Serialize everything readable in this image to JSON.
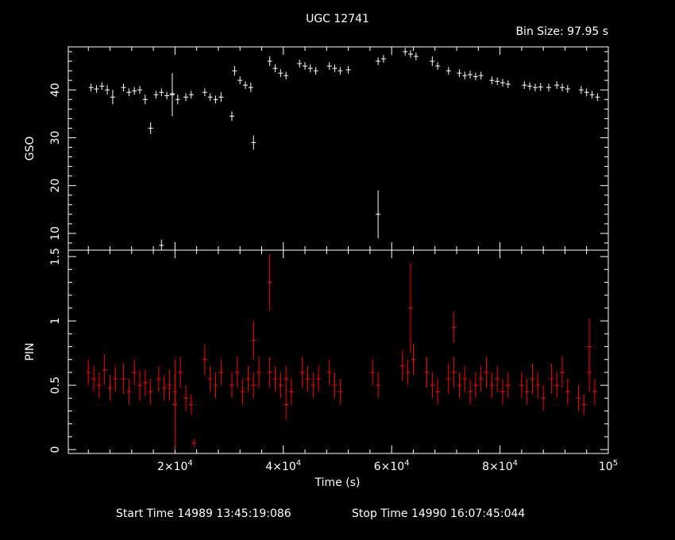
{
  "header": {
    "title": "UGC 12741",
    "bin_size": "Bin Size:  97.95 s"
  },
  "footer": {
    "start_time": "Start Time 14989 13:45:19:086",
    "stop_time": "Stop Time 14990 16:07:45:044"
  },
  "chart_data": [
    {
      "type": "scatter",
      "ylabel": "GSO",
      "ylim": [
        6.5,
        49
      ],
      "yticks": [
        "10",
        "20",
        "30",
        "40"
      ],
      "color": "#ffffff",
      "series": [
        {
          "x": [
            4500,
            5500,
            6500,
            7500,
            8500,
            10500,
            11500,
            12500,
            13500,
            14500,
            16500,
            17500,
            18500,
            19500,
            20500,
            22000,
            23000,
            25500,
            26500,
            27500,
            28500,
            31000,
            32000,
            33000,
            34000,
            37500,
            38500,
            39500,
            40500,
            43000,
            44000,
            45000,
            46000,
            48500,
            49500,
            50500,
            52000,
            57500,
            58500,
            62500,
            63500,
            64500,
            67500,
            68500,
            70500,
            72500,
            73500,
            74500,
            75500,
            76500,
            78500,
            79500,
            80500,
            81500,
            84500,
            85500,
            86500,
            87500,
            89000,
            90500,
            91500,
            92500,
            95000,
            96000,
            97000,
            98000
          ],
          "y": [
            40.5,
            40.2,
            40.8,
            40.0,
            38.5,
            40.5,
            39.5,
            39.8,
            40.0,
            38.0,
            39.0,
            39.5,
            38.8,
            39.2,
            38.0,
            38.5,
            39.0,
            39.5,
            38.5,
            38.0,
            38.5,
            44.0,
            42.0,
            41.0,
            40.5,
            46.0,
            44.5,
            43.5,
            43.0,
            45.5,
            45.0,
            44.5,
            44.0,
            45.0,
            44.5,
            44.0,
            44.2,
            46.0,
            46.5,
            48.0,
            47.5,
            47.0,
            46.0,
            45.0,
            44.0,
            43.5,
            43.0,
            43.2,
            42.8,
            43.0,
            42.0,
            41.8,
            41.5,
            41.2,
            41.0,
            40.8,
            40.5,
            40.6,
            40.5,
            41.0,
            40.5,
            40.2,
            40.0,
            39.5,
            39.0,
            38.5
          ],
          "err": [
            0.8,
            0.8,
            0.8,
            1.0,
            1.5,
            0.8,
            0.8,
            0.8,
            0.8,
            1.0,
            0.8,
            0.8,
            0.8,
            0.8,
            1.0,
            0.8,
            0.8,
            0.8,
            0.8,
            0.8,
            1.0,
            1.0,
            0.8,
            0.8,
            1.0,
            1.0,
            0.8,
            0.8,
            0.8,
            0.8,
            0.8,
            0.8,
            0.8,
            0.8,
            0.8,
            0.8,
            0.8,
            0.8,
            0.8,
            0.8,
            0.8,
            0.8,
            1.0,
            0.8,
            0.8,
            0.8,
            0.8,
            0.8,
            0.8,
            0.8,
            0.8,
            0.8,
            0.8,
            0.8,
            0.8,
            0.8,
            0.8,
            0.8,
            0.8,
            0.8,
            0.8,
            0.8,
            0.8,
            0.8,
            0.8,
            0.8
          ]
        },
        {
          "x": [
            15500,
            17500,
            19500,
            30500,
            34500,
            57500
          ],
          "y": [
            32,
            7.5,
            39,
            34.5,
            29,
            14
          ],
          "err": [
            1.2,
            1.2,
            4.5,
            1.0,
            1.5,
            5.0
          ]
        }
      ]
    },
    {
      "type": "scatter",
      "ylabel": "PIN",
      "xlabel": "Time (s)",
      "xlim": [
        300,
        100000
      ],
      "ylim": [
        -0.03,
        1.55
      ],
      "yticks": [
        "0",
        "0.5",
        "1",
        "1.5"
      ],
      "xticks": [
        20000,
        40000,
        60000,
        80000,
        100000
      ],
      "xticklabels": [
        [
          "2×10",
          "4"
        ],
        [
          "4×10",
          "4"
        ],
        [
          "6×10",
          "4"
        ],
        [
          "8×10",
          "4"
        ],
        [
          "10",
          "5"
        ]
      ],
      "color": "#ff0000",
      "series": [
        {
          "x": [
            4000,
            5000,
            6000,
            7000,
            8000,
            9000,
            10500,
            11500,
            12500,
            13500,
            14500,
            15500,
            17000,
            18000,
            19000,
            20000,
            21000,
            22000,
            23000,
            25500,
            26500,
            27500,
            28500,
            30500,
            31500,
            32500,
            33500,
            34500,
            35500,
            37500,
            38500,
            39500,
            40500,
            41500,
            43500,
            44500,
            45500,
            46500,
            48500,
            49500,
            50500,
            56500,
            57500,
            62000,
            63000,
            64000,
            66500,
            67500,
            68500,
            70500,
            71500,
            72500,
            73500,
            74500,
            75500,
            76500,
            77500,
            78500,
            79500,
            80500,
            81500,
            84000,
            85000,
            86000,
            87000,
            88000,
            89500,
            90500,
            91500,
            92500,
            94500,
            95500,
            96500,
            97500
          ],
          "y": [
            0.6,
            0.55,
            0.5,
            0.62,
            0.48,
            0.55,
            0.55,
            0.45,
            0.6,
            0.5,
            0.52,
            0.45,
            0.55,
            0.48,
            0.5,
            0.45,
            0.6,
            0.4,
            0.35,
            0.7,
            0.55,
            0.5,
            0.6,
            0.5,
            0.6,
            0.45,
            0.55,
            0.5,
            0.6,
            0.6,
            0.55,
            0.5,
            0.55,
            0.45,
            0.6,
            0.55,
            0.5,
            0.55,
            0.6,
            0.5,
            0.45,
            0.6,
            0.5,
            0.65,
            0.6,
            0.7,
            0.6,
            0.5,
            0.45,
            0.55,
            0.6,
            0.5,
            0.55,
            0.45,
            0.5,
            0.55,
            0.6,
            0.5,
            0.55,
            0.45,
            0.5,
            0.5,
            0.45,
            0.55,
            0.5,
            0.4,
            0.55,
            0.5,
            0.6,
            0.45,
            0.4,
            0.35,
            0.6,
            0.45
          ],
          "err": [
            0.1,
            0.1,
            0.1,
            0.12,
            0.1,
            0.1,
            0.12,
            0.1,
            0.1,
            0.12,
            0.1,
            0.1,
            0.1,
            0.1,
            0.12,
            0.15,
            0.12,
            0.1,
            0.08,
            0.12,
            0.1,
            0.1,
            0.1,
            0.1,
            0.12,
            0.1,
            0.1,
            0.1,
            0.12,
            0.12,
            0.1,
            0.1,
            0.1,
            0.1,
            0.12,
            0.1,
            0.1,
            0.1,
            0.1,
            0.1,
            0.1,
            0.1,
            0.1,
            0.12,
            0.1,
            0.12,
            0.12,
            0.1,
            0.1,
            0.12,
            0.12,
            0.1,
            0.1,
            0.1,
            0.1,
            0.1,
            0.12,
            0.1,
            0.1,
            0.1,
            0.1,
            0.1,
            0.1,
            0.12,
            0.1,
            0.1,
            0.12,
            0.1,
            0.12,
            0.1,
            0.1,
            0.08,
            0.15,
            0.1
          ]
        },
        {
          "x": [
            20000,
            23500,
            34500,
            37500,
            40500,
            63500,
            71500,
            96500
          ],
          "y": [
            0.35,
            0.05,
            0.85,
            1.3,
            0.35,
            1.1,
            0.95,
            0.8
          ],
          "err": [
            0.35,
            0.03,
            0.15,
            0.22,
            0.12,
            0.35,
            0.12,
            0.22
          ]
        }
      ]
    }
  ]
}
